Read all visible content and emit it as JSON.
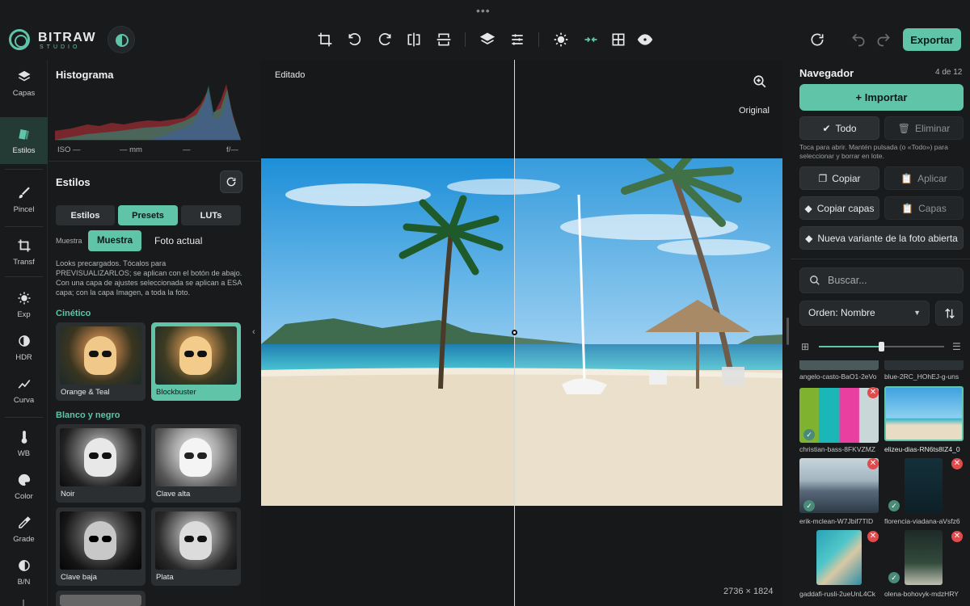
{
  "app": {
    "brand_title": "BITRAW",
    "brand_subtitle": "STUDIO",
    "window_handle": "•••"
  },
  "toolbar": {
    "icons": [
      "crop-icon",
      "rotate-left-icon",
      "rotate-right-icon",
      "flip-horizontal-icon",
      "flip-vertical-icon",
      "layers-icon",
      "sliders-icon",
      "brightness-icon",
      "compare-icon",
      "grid-icon",
      "eye-icon"
    ],
    "export_label": "Exportar"
  },
  "rail": {
    "items": [
      {
        "label": "Capas",
        "icon": "layers-icon"
      },
      {
        "label": "Estilos",
        "icon": "styles-icon"
      },
      {
        "label": "Pincel",
        "icon": "brush-icon"
      },
      {
        "label": "Transf",
        "icon": "crop-icon"
      },
      {
        "label": "Exp",
        "icon": "sun-icon"
      },
      {
        "label": "HDR",
        "icon": "hdr-icon"
      },
      {
        "label": "Curva",
        "icon": "curve-icon"
      },
      {
        "label": "WB",
        "icon": "thermometer-icon"
      },
      {
        "label": "Color",
        "icon": "palette-icon"
      },
      {
        "label": "Grade",
        "icon": "dropper-icon"
      },
      {
        "label": "B/N",
        "icon": "bw-icon"
      }
    ],
    "active": "Estilos"
  },
  "histogram": {
    "title": "Histograma",
    "iso": "ISO —",
    "focal": "— mm",
    "shutter": "—",
    "aperture": "f/—"
  },
  "styles": {
    "title": "Estilos",
    "tabs": [
      "Estilos",
      "Presets",
      "LUTs"
    ],
    "active_tab": "Presets",
    "sample_small_label": "Muestra",
    "sample_button": "Muestra",
    "current_photo": "Foto actual",
    "description": "Looks precargados. Tócalos para PREVISUALIZARLOS; se aplican con el botón de abajo. Con una capa de ajustes seleccionada se aplican a ESA capa; con la capa Imagen, a toda la foto.",
    "categories": [
      {
        "name": "Cinético",
        "presets": [
          "Orange & Teal",
          "Blockbuster"
        ],
        "selected": "Blockbuster"
      },
      {
        "name": "Blanco y negro",
        "presets": [
          "Noir",
          "Clave alta",
          "Clave baja",
          "Plata"
        ]
      }
    ]
  },
  "canvas": {
    "edited_label": "Editado",
    "original_label": "Original",
    "dimensions": "2736 × 1824"
  },
  "navigator": {
    "title": "Navegador",
    "counter": "4 de 12",
    "import_label": "Importar",
    "all_label": "Todo",
    "delete_label": "Eliminar",
    "hint": "Toca para abrir. Mantén pulsada (o «Todo») para seleccionar y borrar en lote.",
    "copy_label": "Copiar",
    "apply_label": "Aplicar",
    "copy_layers_label": "Copiar capas",
    "layers_label": "Capas",
    "new_variant_label": "Nueva variante de la foto abierta",
    "search_placeholder": "Buscar...",
    "sort_label": "Orden: Nombre",
    "thumb_size_fraction": 0.5,
    "photos": [
      "angelo-casto-BaO1-2eVo",
      "blue-2RC_HOhEJ-g-uns",
      "christian-bass-8FKVZMZ",
      "elizeu-dias-RN6ts8IZ4_0",
      "erik-mclean-W7Jbif7TID",
      "florencia-viadana-aVsfz6",
      "gaddafi-rusli-2ueUnL4Ck",
      "olena-bohovyk-mdzHRY"
    ]
  },
  "colors": {
    "accent": "#5fc4a8",
    "danger": "#e14b4b",
    "background": "#181a1b"
  }
}
